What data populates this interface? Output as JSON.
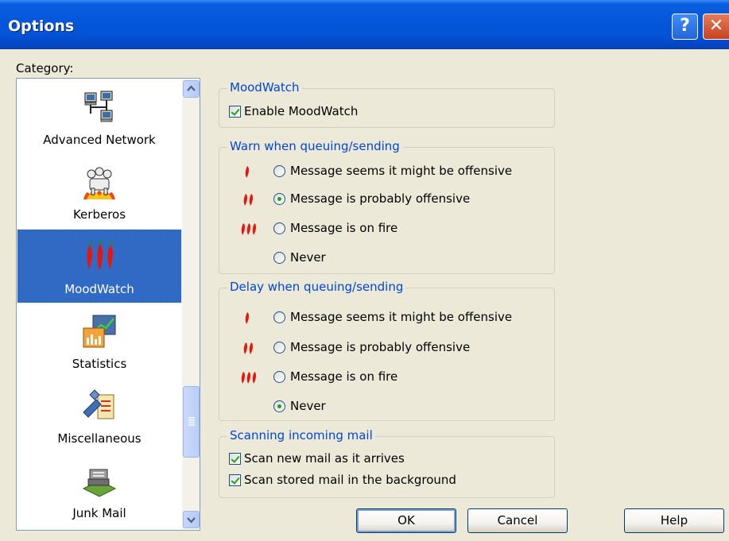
{
  "window": {
    "title": "Options"
  },
  "category": {
    "label": "Category:",
    "items": [
      {
        "label": "Advanced Network",
        "icon": "network-computers-icon"
      },
      {
        "label": "Kerberos",
        "icon": "three-headed-dog-icon"
      },
      {
        "label": "MoodWatch",
        "icon": "chili-peppers-icon"
      },
      {
        "label": "Statistics",
        "icon": "bar-chart-icon"
      },
      {
        "label": "Miscellaneous",
        "icon": "tools-icon"
      },
      {
        "label": "Junk Mail",
        "icon": "junk-mail-icon"
      }
    ],
    "selected": "MoodWatch"
  },
  "moodwatch": {
    "title": "MoodWatch",
    "enable_label": "Enable MoodWatch",
    "enable_checked": true
  },
  "warn": {
    "title": "Warn when queuing/sending",
    "options": [
      {
        "label": "Message seems it might be offensive",
        "peppers": 1,
        "checked": false
      },
      {
        "label": "Message is probably offensive",
        "peppers": 2,
        "checked": true
      },
      {
        "label": "Message is on fire",
        "peppers": 3,
        "checked": false
      },
      {
        "label": "Never",
        "peppers": 0,
        "checked": false
      }
    ]
  },
  "delay": {
    "title": "Delay when queuing/sending",
    "options": [
      {
        "label": "Message seems it might be offensive",
        "peppers": 1,
        "checked": false
      },
      {
        "label": "Message is probably offensive",
        "peppers": 2,
        "checked": false
      },
      {
        "label": "Message is on fire",
        "peppers": 3,
        "checked": false
      },
      {
        "label": "Never",
        "peppers": 0,
        "checked": true
      }
    ]
  },
  "scanning": {
    "title": "Scanning incoming mail",
    "options": [
      {
        "label": "Scan new mail as it arrives",
        "checked": true
      },
      {
        "label": "Scan stored mail in the background",
        "checked": true
      }
    ]
  },
  "buttons": {
    "ok": "OK",
    "cancel": "Cancel",
    "help": "Help"
  },
  "colors": {
    "title_bar": "#0453D7",
    "selection": "#316AC5",
    "group_title": "#0046D5",
    "pepper": "#D81E05"
  }
}
